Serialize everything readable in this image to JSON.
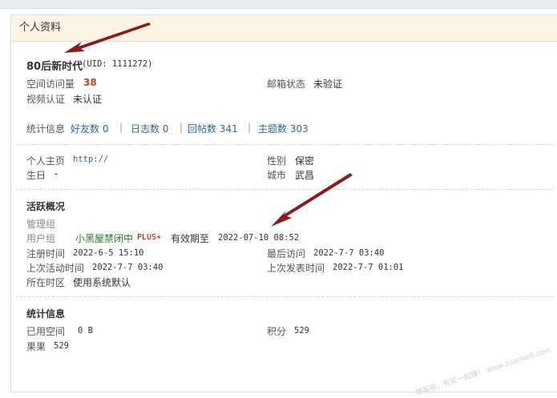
{
  "panel": {
    "title": "个人资料"
  },
  "user": {
    "name": "80后新时代",
    "uid": "(UID: 1111272)"
  },
  "basic": {
    "visits_label": "空间访问量",
    "visits_value": "38",
    "email_label": "邮箱状态",
    "email_value": "未验证",
    "video_label": "视频认证",
    "video_value": "未认证"
  },
  "stats": {
    "label": "统计信息",
    "items": [
      {
        "label": "好友数 0"
      },
      {
        "label": "日志数 0"
      },
      {
        "label": "回帖数 341"
      },
      {
        "label": "主题数 303"
      }
    ]
  },
  "profile": {
    "homepage_label": "个人主页",
    "homepage_value": "http://",
    "gender_label": "性别",
    "gender_value": "保密",
    "birthday_label": "生日",
    "birthday_value": "-",
    "city_label": "城市",
    "city_value": "武昌"
  },
  "activity": {
    "heading": "活跃概况",
    "admin_group_label": "管理组",
    "user_group_label": "用户组",
    "user_group_value": "小黑屋禁闭中",
    "plus": "PLUS+",
    "expire_label": "有效期至",
    "expire_value": "2022-07-10 08:52",
    "reg_label": "注册时间",
    "reg_value": "2022-6-5 15:10",
    "last_visit_label": "最后访问",
    "last_visit_value": "2022-7-7 03:40",
    "last_active_label": "上次活动时间",
    "last_active_value": "2022-7-7 03:40",
    "last_post_label": "上次发表时间",
    "last_post_value": "2022-7-7 01:01",
    "tz_label": "所在时区",
    "tz_value": "使用系统默认"
  },
  "stats2": {
    "heading": "统计信息",
    "space_label": "已用空间",
    "space_value": "0 B",
    "points_label": "积分",
    "points_value": "529",
    "fruit_label": "果果",
    "fruit_value": "529"
  },
  "watermark": "赚客吧，有奖一起赚！ www.zuanke8.com",
  "colors": {
    "arrow": "#8b1a1a",
    "header_bg": "#fdf5e4",
    "accent_red": "#c4451c",
    "link": "#336699"
  }
}
